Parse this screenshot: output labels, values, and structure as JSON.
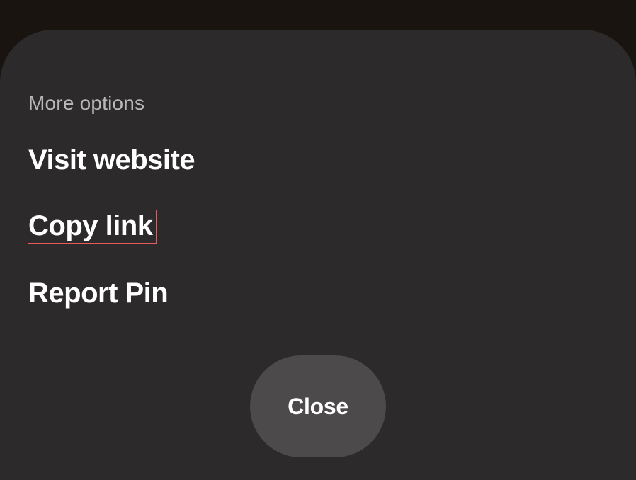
{
  "sheet": {
    "section_title": "More options",
    "items": [
      {
        "label": "Visit website"
      },
      {
        "label": "Copy link"
      },
      {
        "label": "Report Pin"
      }
    ],
    "close_label": "Close"
  }
}
